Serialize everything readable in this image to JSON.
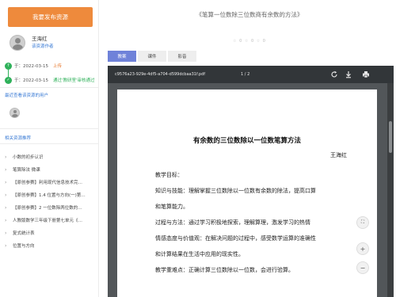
{
  "sidebar": {
    "publish_button": "我要发布资源",
    "user_name": "王海红",
    "user_link": "该资源作者",
    "timeline": [
      {
        "date": "于：2022-03-15",
        "status": "上传"
      },
      {
        "date": "于：2022-03-15",
        "status": "通过'教研室'审核通过"
      }
    ],
    "viewers_title": "最近查看该资源的用户",
    "related_title": "相关资源推荐",
    "related_items": [
      "小数的初步认识",
      "笔算除法 微课",
      "【原创参赛】利用现代信息技术完…",
      "【原创参赛】1.4 位置与方向(一)第…",
      "【原创参赛】2 一位数除两位数的…",
      "人教版数学三年级下册第七单元《…",
      "复式统计表",
      "位置与方向"
    ],
    "colors": {
      "accent": "#ee8a3c",
      "timeline": "#2fb15a",
      "link": "#3a7bd5"
    }
  },
  "main": {
    "title": "《笔算一位数除三位数商有余数的方法》",
    "rating": "☆ 0 ☆ 0 ☆ 0",
    "tabs": [
      {
        "label": "教案",
        "active": true
      },
      {
        "label": "课件",
        "active": false
      },
      {
        "label": "影音",
        "active": false
      }
    ],
    "viewer": {
      "filename": "c9576a23-929e-4df5-a704-d599dcbaa31f.pdf",
      "page": "1",
      "page_sep": "/",
      "total": "2",
      "icons": [
        "rotate-icon",
        "download-icon",
        "print-icon"
      ]
    },
    "document": {
      "heading": "有余数的三位数除以一位数笔算方法",
      "author": "王海红",
      "lines": [
        "教学目标：",
        "知识与技能：理解掌握三位数除以一位数有余数的除法，提高口算",
        "和笔算能力。",
        "过程与方法：通过学习积极地探索，理解算理，激发学习的热情",
        "情感态度与价值观：在解决问题的过程中，感受数学运算的准确性",
        "和计算结果在生活中应用的现实性。",
        "教学重难点：正确计算三位数除以一位数，会进行验算。"
      ]
    },
    "zoom": {
      "fit": "⛶",
      "in": "+",
      "out": "−"
    }
  }
}
